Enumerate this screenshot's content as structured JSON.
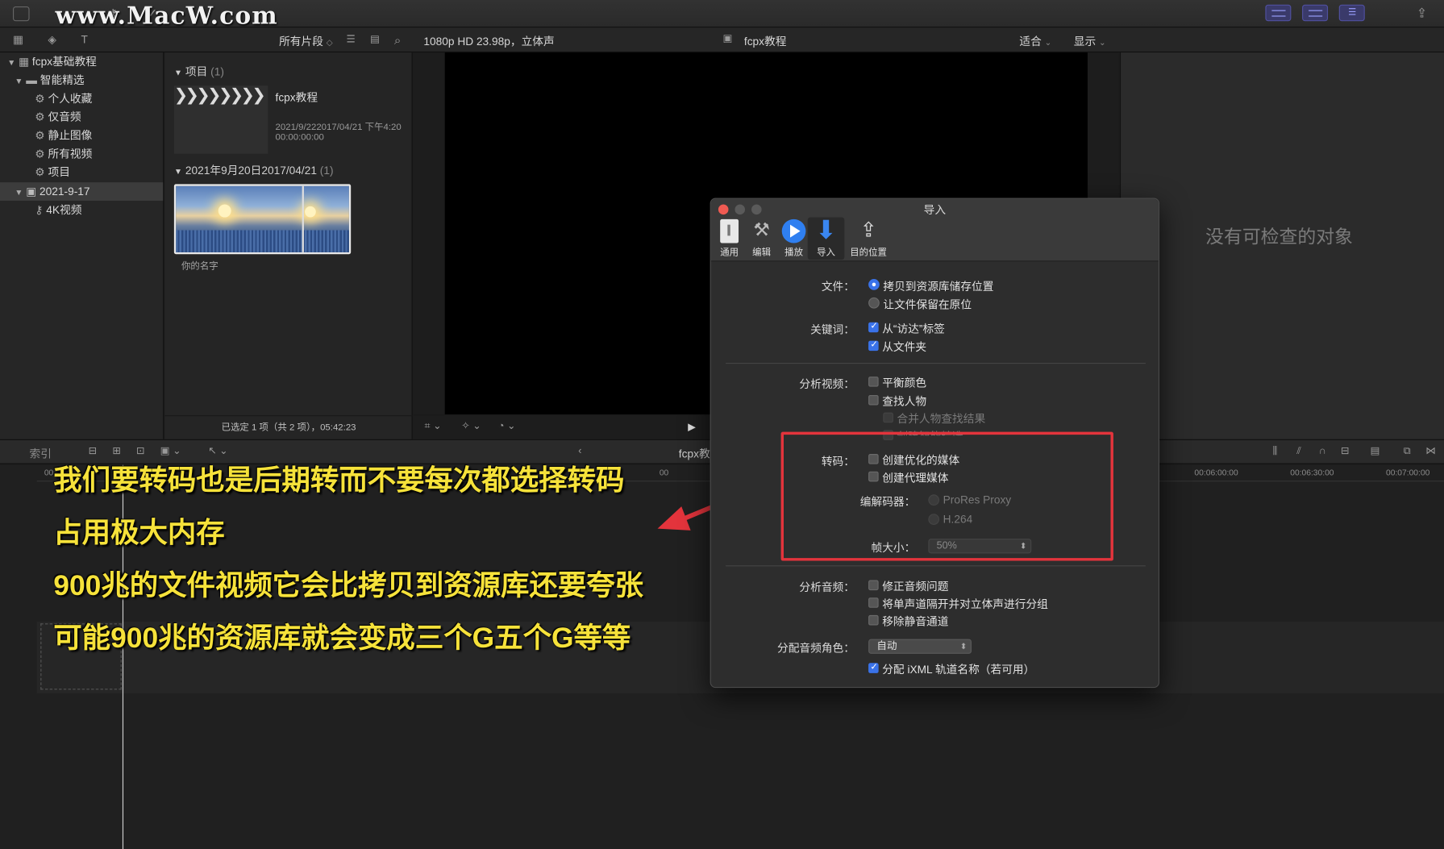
{
  "watermark": "www.MacW.com",
  "toolbar": {
    "clip_filter": "所有片段",
    "format": "1080p HD 23.98p，立体声",
    "project_name": "fcpx教程",
    "fit_label": "适合",
    "display_label": "显示"
  },
  "library": {
    "root": "fcpx基础教程",
    "smart_group": "智能精选",
    "smart_items": [
      "个人收藏",
      "仅音频",
      "静止图像",
      "所有视频",
      "项目"
    ],
    "event": "2021-9-17",
    "event_item": "4K视频"
  },
  "browser": {
    "group1_title": "项目",
    "group1_count": "(1)",
    "project_title": "fcpx教程",
    "project_date": "2021/9/222017/04/21 下午4:20",
    "project_duration": "00:00:00:00",
    "group2_title": "2021年9月20日2017/04/21",
    "group2_count": "(1)",
    "clip_name": "你的名字",
    "status": "已选定 1 项（共 2 项），05:42:23"
  },
  "inspector": {
    "empty_text": "没有可检查的对象"
  },
  "timeline": {
    "index_label": "索引",
    "title": "fcpx教",
    "ruler": [
      "00:06:00:00",
      "00:06:30:00",
      "00:07:00:00"
    ],
    "ruler_left": "00",
    "ruler_mid": "00"
  },
  "dialog": {
    "title": "导入",
    "tabs": [
      {
        "label": "通用",
        "icon": "general-icon"
      },
      {
        "label": "编辑",
        "icon": "edit-icon"
      },
      {
        "label": "播放",
        "icon": "play-icon"
      },
      {
        "label": "导入",
        "icon": "import-icon"
      },
      {
        "label": "目的位置",
        "icon": "share-icon"
      }
    ],
    "files_label": "文件：",
    "files_opt1": "拷贝到资源库储存位置",
    "files_opt2": "让文件保留在原位",
    "keywords_label": "关键词：",
    "keywords_opt1": "从“访达”标签",
    "keywords_opt2": "从文件夹",
    "analyze_video_label": "分析视频：",
    "balance_color": "平衡颜色",
    "find_people": "查找人物",
    "merge_people": "合并人物查找结果",
    "smart_collections": "创建智能精选",
    "transcode_label": "转码：",
    "optimized_media": "创建优化的媒体",
    "proxy_media": "创建代理媒体",
    "codec_label": "编解码器：",
    "codec_opt1": "ProRes Proxy",
    "codec_opt2": "H.264",
    "frame_size_label": "帧大小：",
    "frame_size_value": "50%",
    "analyze_audio_label": "分析音频：",
    "fix_audio": "修正音频问题",
    "separate_mono": "将单声道隔开并对立体声进行分组",
    "remove_silent": "移除静音通道",
    "audio_role_label": "分配音频角色：",
    "audio_role_value": "自动",
    "ixml_label": "分配 iXML 轨道名称（若可用）"
  },
  "captions": [
    "我们要转码也是后期转而不要每次都选择转码",
    "占用极大内存",
    "900兆的文件视频它会比拷贝到资源库还要夸张",
    "可能900兆的资源库就会变成三个G五个G等等"
  ],
  "colors": {
    "highlight_box": "#e3343c",
    "caption": "#f6e23a",
    "accent": "#3a72e8"
  }
}
